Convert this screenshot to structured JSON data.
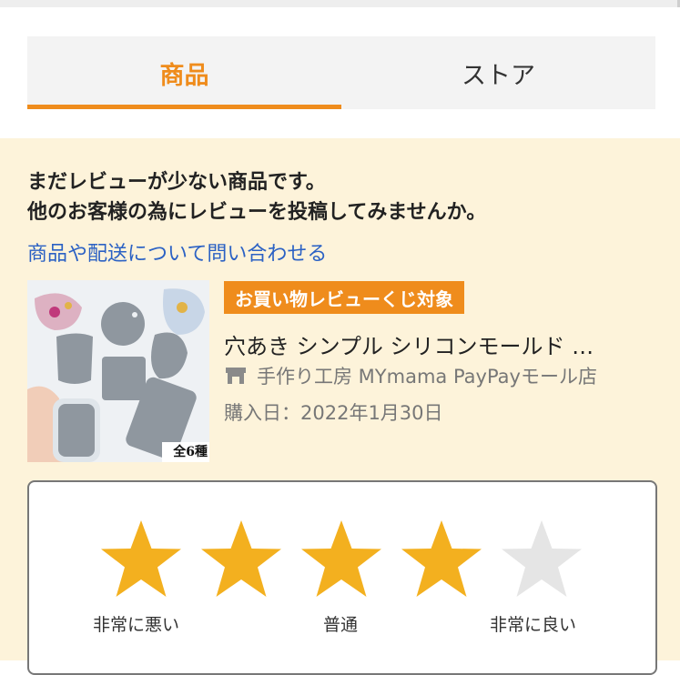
{
  "tabs": {
    "products": "商品",
    "store": "ストア"
  },
  "notice": {
    "line1": "まだレビューが少ない商品です。",
    "line2": "他のお客様の為にレビューを投稿してみませんか。"
  },
  "contact_link": "商品や配送について問い合わせる",
  "product": {
    "badge": "お買い物レビューくじ対象",
    "title": "穴あき シンプル シリコンモールド …",
    "store": "手作り工房 MYmama PayPayモール店",
    "purchase_date": "購入日：2022年1月30日",
    "image_caption": "全6種",
    "store_icon": "store-icon"
  },
  "rating": {
    "value": 4,
    "max": 5,
    "labels": {
      "low": "非常に悪い",
      "mid": "普通",
      "high": "非常に良い"
    },
    "colors": {
      "filled": "#f3b01f",
      "empty": "#e5e5e5"
    }
  },
  "colors": {
    "accent": "#ef8c1c",
    "link": "#2b61c4",
    "panel_bg": "#fdf3da"
  }
}
